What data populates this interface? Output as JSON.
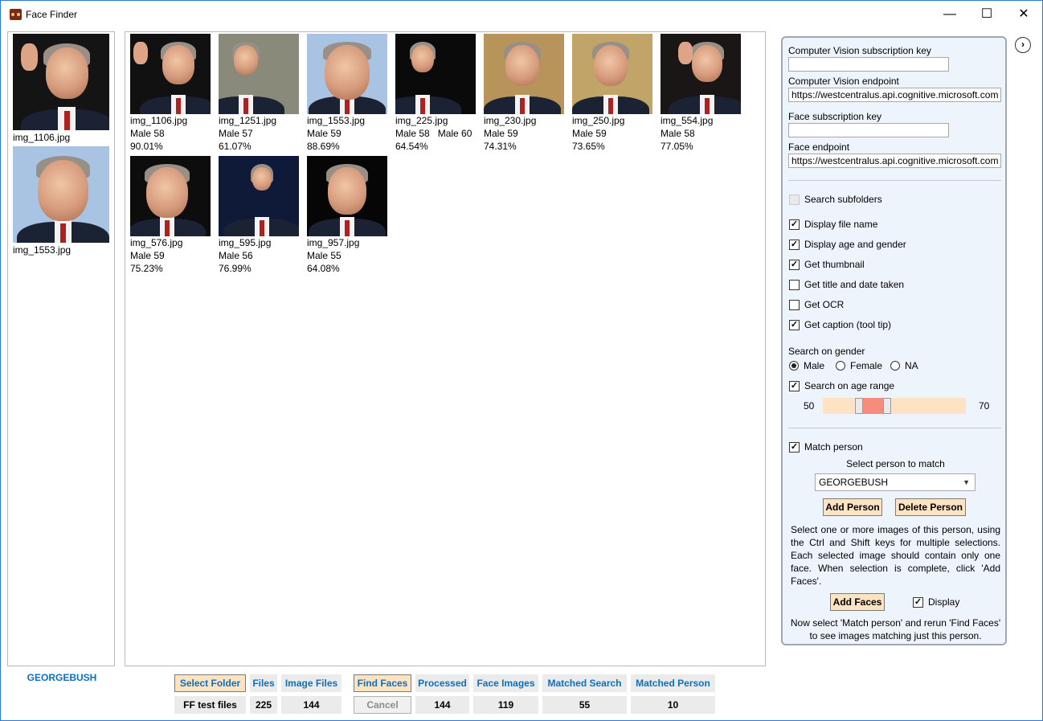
{
  "window": {
    "title": "Face Finder",
    "minimize": "—",
    "maximize": "☐",
    "close": "✕"
  },
  "person_panel": {
    "items": [
      {
        "label": "img_1106.jpg",
        "bg": "#141414"
      },
      {
        "label": "img_1553.jpg",
        "bg": "#a9c4e2"
      }
    ],
    "person_name": "GEORGEBUSH"
  },
  "results": [
    {
      "file": "img_1106.jpg",
      "info": "Male 58",
      "score": "90.01%",
      "bg": "#111111"
    },
    {
      "file": "img_1251.jpg",
      "info": "Male 57",
      "score": "61.07%",
      "bg": "#8a8a7a"
    },
    {
      "file": "img_1553.jpg",
      "info": "Male 59",
      "score": "88.69%",
      "bg": "#a9c4e2"
    },
    {
      "file": "img_225.jpg",
      "info": "Male 58   Male 60",
      "score": "64.54%",
      "bg": "#0a0a0a"
    },
    {
      "file": "img_230.jpg",
      "info": "Male 59",
      "score": "74.31%",
      "bg": "#b7955a"
    },
    {
      "file": "img_250.jpg",
      "info": "Male 59",
      "score": "73.65%",
      "bg": "#c1a468"
    },
    {
      "file": "img_554.jpg",
      "info": "Male 58",
      "score": "77.05%",
      "bg": "#1a1616"
    },
    {
      "file": "img_576.jpg",
      "info": "Male 59",
      "score": "75.23%",
      "bg": "#0d0d0d"
    },
    {
      "file": "img_595.jpg",
      "info": "Male 56",
      "score": "76.99%",
      "bg": "#0f1a38"
    },
    {
      "file": "img_957.jpg",
      "info": "Male 55",
      "score": "64.08%",
      "bg": "#060606"
    }
  ],
  "settings": {
    "cv_key_label": "Computer Vision subscription key",
    "cv_key_value": "",
    "cv_endpoint_label": "Computer Vision endpoint",
    "cv_endpoint_value": "https://westcentralus.api.cognitive.microsoft.com",
    "face_key_label": "Face subscription key",
    "face_key_value": "",
    "face_endpoint_label": "Face endpoint",
    "face_endpoint_value": "https://westcentralus.api.cognitive.microsoft.com",
    "options": [
      {
        "label": "Search subfolders",
        "checked": false,
        "disabled": true
      },
      {
        "label": "Display file name",
        "checked": true
      },
      {
        "label": "Display age and gender",
        "checked": true
      },
      {
        "label": "Get thumbnail",
        "checked": true
      },
      {
        "label": "Get title and date taken",
        "checked": false
      },
      {
        "label": "Get OCR",
        "checked": false
      },
      {
        "label": "Get caption (tool tip)",
        "checked": true
      }
    ],
    "gender_label": "Search on gender",
    "gender_options": [
      {
        "label": "Male",
        "selected": true
      },
      {
        "label": "Female",
        "selected": false
      },
      {
        "label": "NA",
        "selected": false
      }
    ],
    "age_range": {
      "label": "Search on age range",
      "checked": true,
      "min": "50",
      "max": "70",
      "low": 55,
      "high": 59
    },
    "match_person": {
      "label": "Match person",
      "checked": true
    },
    "select_person_label": "Select person to match",
    "selected_person": "GEORGEBUSH",
    "add_person": "Add Person",
    "delete_person": "Delete Person",
    "help_text": "Select one or more images of this person, using the Ctrl and Shift keys for multiple selections. Each selected image should contain only one face. When selection is complete, click 'Add Faces'.",
    "add_faces": "Add Faces",
    "display": {
      "label": "Display",
      "checked": true
    },
    "help_text2": "Now select 'Match person' and rerun 'Find Faces' to see images matching just this person."
  },
  "bottom": {
    "select_folder": "Select Folder",
    "folder_name": "FF test files",
    "files_label": "Files",
    "files_value": "225",
    "image_files_label": "Image Files",
    "image_files_value": "144",
    "find_faces": "Find Faces",
    "cancel": "Cancel",
    "processed_label": "Processed",
    "processed_value": "144",
    "face_images_label": "Face Images",
    "face_images_value": "119",
    "matched_search_label": "Matched Search",
    "matched_search_value": "55",
    "matched_person_label": "Matched Person",
    "matched_person_value": "10"
  },
  "icons": {
    "app": "face-finder-app-icon",
    "expand": "chevron-right-circle-icon"
  },
  "colors": {
    "accent_text": "#0b6fc2",
    "button_bg": "#fce3c2",
    "range_fill": "#f58d7e",
    "panel_bg": "#eef4fb"
  }
}
